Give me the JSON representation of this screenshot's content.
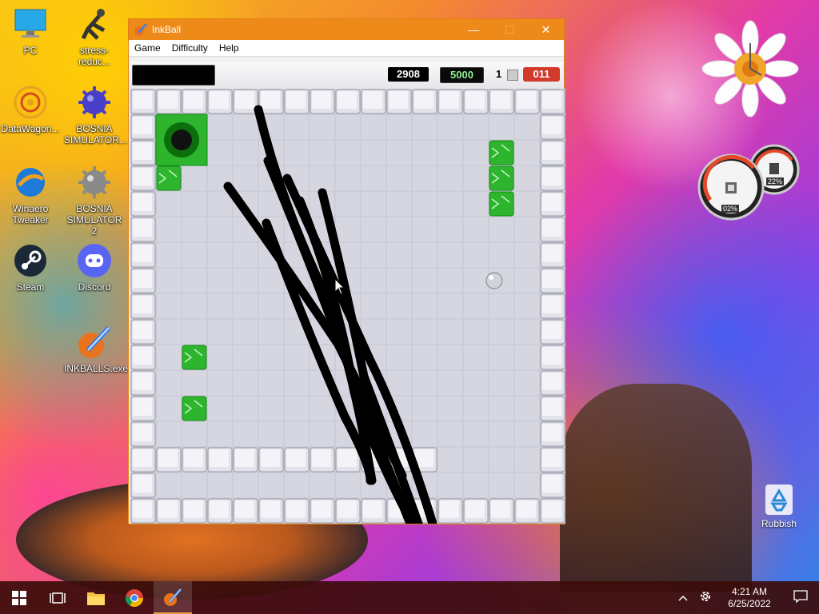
{
  "desktop": {
    "icons": [
      {
        "label": "PC"
      },
      {
        "label": "stress-reduc..."
      },
      {
        "label": "DataWagon..."
      },
      {
        "label": "BOSNIA SIMULATOR..."
      },
      {
        "label": "Winaero Tweaker"
      },
      {
        "label": "BOSNIA SIMULATOR 2"
      },
      {
        "label": "Steam"
      },
      {
        "label": "Discord"
      },
      {
        "label": "INKBALLS.exe"
      }
    ],
    "recycle_bin": {
      "label": "Rubbish"
    },
    "gadgets": {
      "meter_cpu": "02%",
      "meter_ram": "22%"
    }
  },
  "window": {
    "title": "InkBall",
    "controls": {
      "minimize": "—",
      "maximize": "☐",
      "close": "✕"
    },
    "menu": [
      "Game",
      "Difficulty",
      "Help"
    ]
  },
  "game": {
    "score": "2908",
    "goal_score": "5000",
    "level": "1",
    "balls_remaining": "011",
    "colors": {
      "green": "#2db52d",
      "tile": "#d6d6e0",
      "ink": "#000000"
    }
  },
  "taskbar": {
    "clock_time": "4:21 AM",
    "clock_date": "6/25/2022"
  }
}
